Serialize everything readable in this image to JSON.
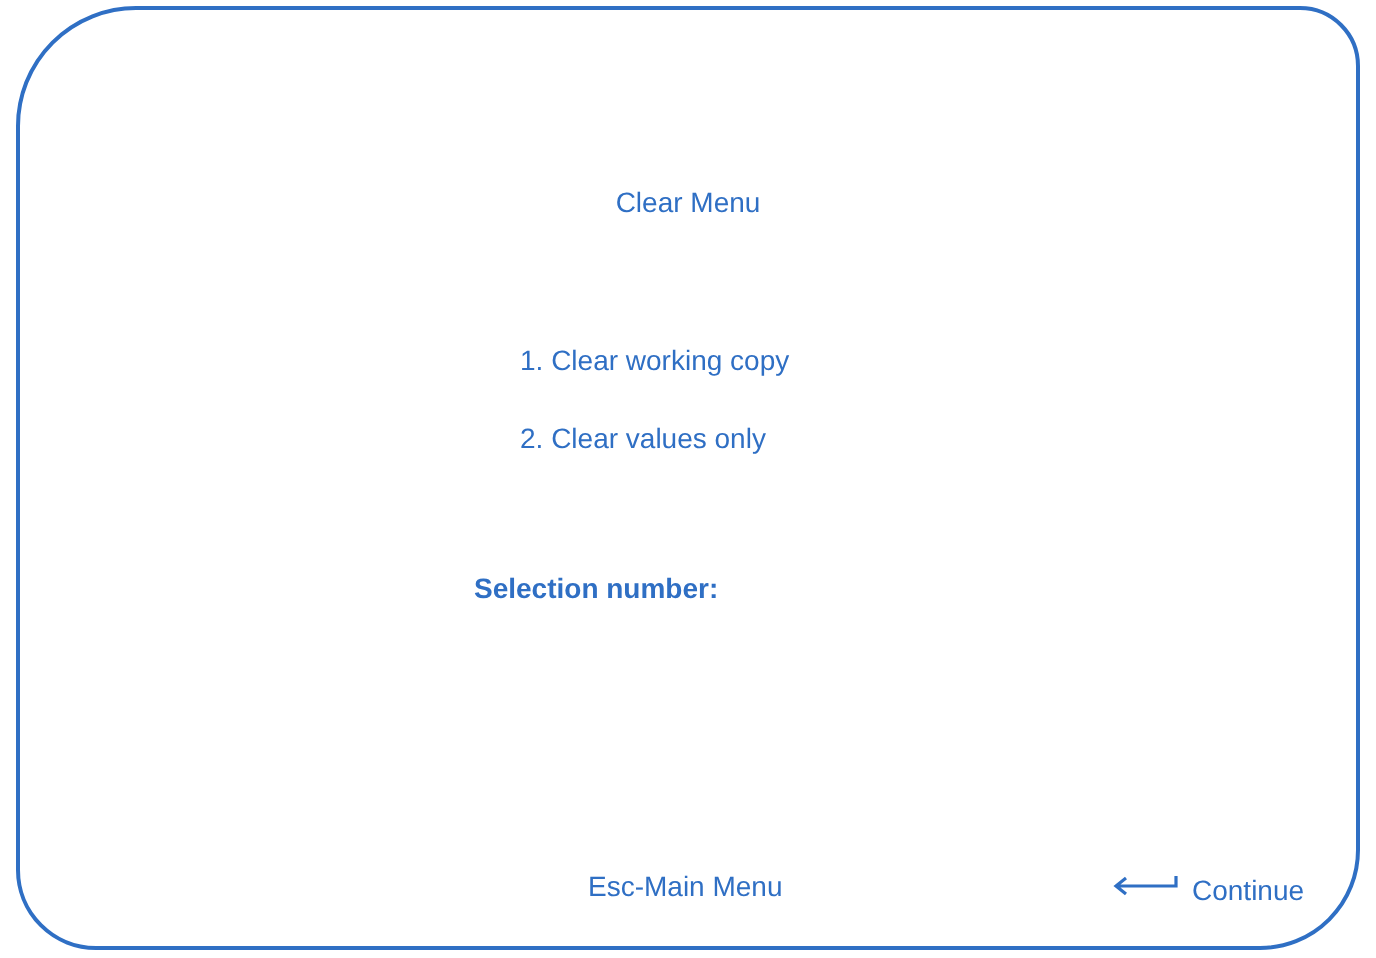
{
  "title": "Clear Menu",
  "options": [
    {
      "label": "1. Clear working copy"
    },
    {
      "label": "2. Clear values only"
    }
  ],
  "prompt": "Selection number:",
  "footer": {
    "escape": "Esc-Main Menu",
    "continue": "Continue"
  }
}
